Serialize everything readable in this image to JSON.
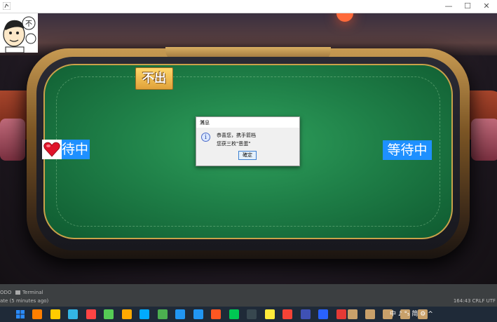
{
  "window": {
    "minimize_glyph": "—",
    "maximize_glyph": "☐",
    "close_glyph": "✕"
  },
  "game": {
    "pass_bubble": "不出",
    "left_player_status": "待中",
    "right_player_status": "等待中",
    "avatar_icon": "cartoon-player-avatar"
  },
  "dialog": {
    "title": "消息",
    "close_glyph": "✕",
    "line1": "恭喜您，携手箭档",
    "line2": "您获三枚\"恩蛋\"",
    "ok_label": "確定",
    "icon": "info-icon"
  },
  "ide": {
    "tab_todo": "ODO",
    "tab_terminal": "Terminal",
    "status_text": "ate (5 minutes ago)",
    "right_status": "164:43  CRLF  UTF"
  },
  "taskbar": {
    "tray_text": "中 ♪ °₅ 简 ⚙  ^",
    "colors": [
      "#ff7f00",
      "#ffcc00",
      "#33b5e5",
      "#ff4444",
      "#55cc55",
      "#ffaa00",
      "#00aaff",
      "#4caf50",
      "#2196f3",
      "#2196f3",
      "#ff5722",
      "#00c853",
      "#37474f",
      "#ffeb3b",
      "#f44336",
      "#3f51b5",
      "#2962ff",
      "#e53935",
      "#c8a06a",
      "#c8a06a",
      "#c8a06a",
      "#c8a06a",
      "#c8a06a"
    ]
  },
  "colors": {
    "felt": "#1f8048",
    "status_blue": "#1e90ff",
    "rail_gold": "#c79a52"
  }
}
